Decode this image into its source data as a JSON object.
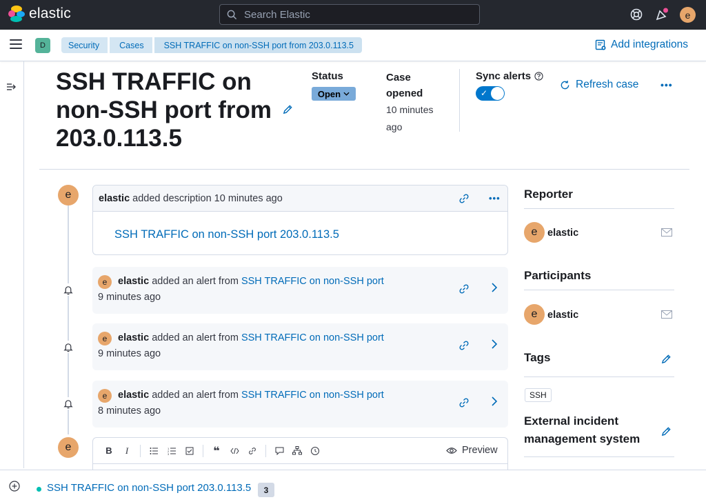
{
  "header": {
    "brand": "elastic",
    "search_placeholder": "Search Elastic",
    "user_initial": "e"
  },
  "nav": {
    "space_initial": "D",
    "breadcrumbs": [
      "Security",
      "Cases",
      "SSH TRAFFIC on non-SSH port from 203.0.113.5"
    ],
    "add_integrations": "Add integrations"
  },
  "case": {
    "title": "SSH TRAFFIC on non-SSH port from 203.0.113.5",
    "status_label": "Status",
    "status_value": "Open",
    "opened_label": "Case opened",
    "opened_value": "10 minutes ago",
    "sync_label": "Sync alerts",
    "sync_enabled": true,
    "refresh_label": "Refresh case"
  },
  "timeline": {
    "description": {
      "user": "elastic",
      "action": "added description 10 minutes ago",
      "text": "SSH TRAFFIC on non-SSH port 203.0.113.5",
      "avatar": "e"
    },
    "alerts": [
      {
        "user": "elastic",
        "action": "added an alert from",
        "rule": "SSH TRAFFIC on non-SSH port",
        "time": "9 minutes ago",
        "avatar": "e"
      },
      {
        "user": "elastic",
        "action": "added an alert from",
        "rule": "SSH TRAFFIC on non-SSH port",
        "time": "9 minutes ago",
        "avatar": "e"
      },
      {
        "user": "elastic",
        "action": "added an alert from",
        "rule": "SSH TRAFFIC on non-SSH port",
        "time": "8 minutes ago",
        "avatar": "e"
      }
    ],
    "editor": {
      "avatar": "e",
      "preview_label": "Preview"
    }
  },
  "sidebar": {
    "reporter_heading": "Reporter",
    "reporter_name": "elastic",
    "participants_heading": "Participants",
    "participant_name": "elastic",
    "tags_heading": "Tags",
    "tags": [
      "SSH"
    ],
    "external_heading": "External incident management system",
    "avatar": "e"
  },
  "bottom": {
    "case_link": "SSH TRAFFIC on non-SSH port 203.0.113.5",
    "count": "3"
  },
  "colors": {
    "link": "#006bb8",
    "avatar": "#e7a66b",
    "topbar": "#25282f",
    "toggle": "#0077cc"
  }
}
